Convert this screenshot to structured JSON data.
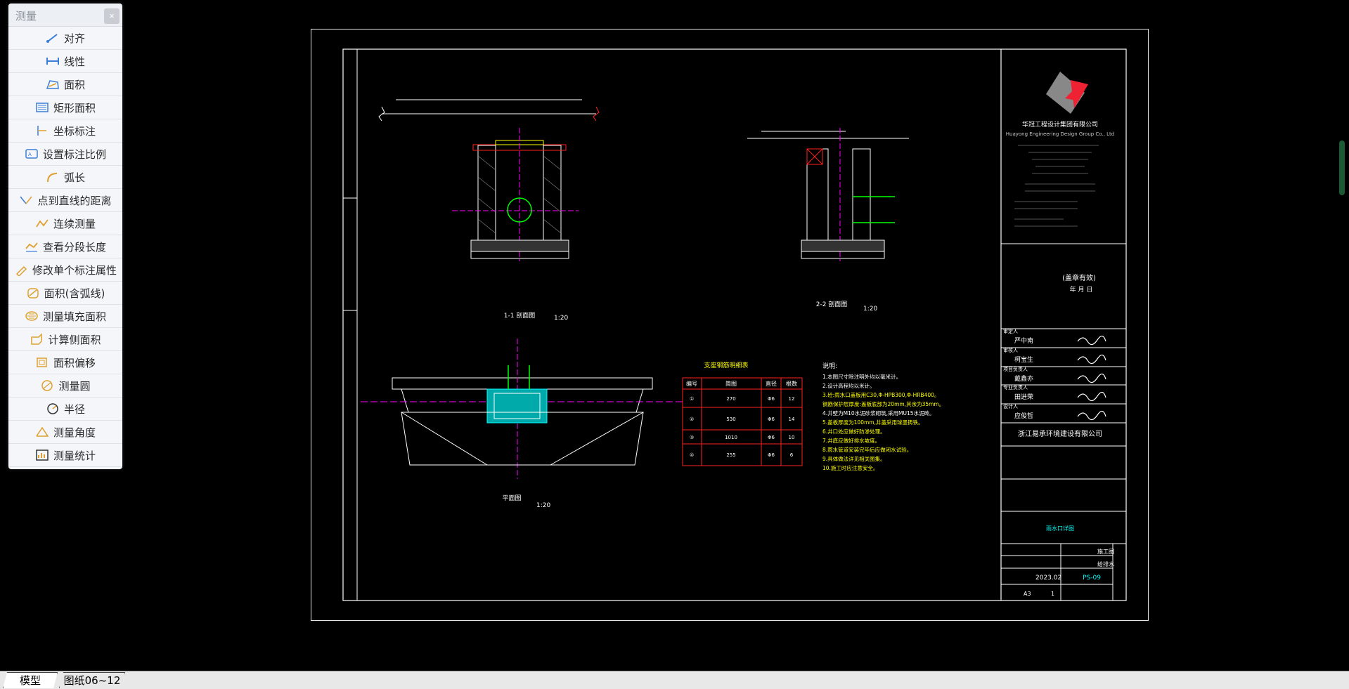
{
  "panel": {
    "title": "测量",
    "close": "×",
    "tools": [
      {
        "label": "对齐",
        "icon": "align-measure-icon"
      },
      {
        "label": "线性",
        "icon": "linear-measure-icon"
      },
      {
        "label": "面积",
        "icon": "area-icon"
      },
      {
        "label": "矩形面积",
        "icon": "rectangle-area-icon"
      },
      {
        "label": "坐标标注",
        "icon": "coordinate-icon"
      },
      {
        "label": "设置标注比例",
        "icon": "scale-icon"
      },
      {
        "label": "弧长",
        "icon": "arc-length-icon"
      },
      {
        "label": "点到直线的距离",
        "icon": "point-line-distance-icon"
      },
      {
        "label": "连续测量",
        "icon": "continuous-measure-icon"
      },
      {
        "label": "查看分段长度",
        "icon": "segment-length-icon"
      },
      {
        "label": "修改单个标注属性",
        "icon": "edit-dimension-icon"
      },
      {
        "label": "面积(含弧线)",
        "icon": "arc-area-icon"
      },
      {
        "label": "测量填充面积",
        "icon": "fill-area-icon"
      },
      {
        "label": "计算侧面积",
        "icon": "side-area-icon"
      },
      {
        "label": "面积偏移",
        "icon": "area-offset-icon"
      },
      {
        "label": "测量圆",
        "icon": "circle-measure-icon"
      },
      {
        "label": "半径",
        "icon": "radius-icon"
      },
      {
        "label": "测量角度",
        "icon": "angle-icon"
      },
      {
        "label": "测量统计",
        "icon": "statistics-icon"
      }
    ]
  },
  "tabs": {
    "model": "模型",
    "sheet": "图纸06~12"
  },
  "drawing": {
    "view1_label": "1-1 剖面图",
    "view1_scale": "1:20",
    "view2_label": "2-2 剖面图",
    "view2_scale": "1:20",
    "plan_label": "平面图",
    "plan_scale": "1:20",
    "rebar_table_title": "支座钢筋明细表",
    "rebar_headers": [
      "编号",
      "简图",
      "直径",
      "根数"
    ],
    "rebar_rows": [
      {
        "no": "①",
        "dim": "270",
        "dia": "Φ6",
        "qty": "12"
      },
      {
        "no": "②",
        "dim": "530",
        "dia": "Φ6",
        "qty": "14"
      },
      {
        "no": "③",
        "dim": "1010",
        "dia": "Φ6",
        "qty": "10"
      },
      {
        "no": "④",
        "dim": "255",
        "dia": "Φ6",
        "qty": "6"
      }
    ],
    "notes_title": "说明:",
    "notes": [
      "1.本图尺寸除注明外均以毫米计。",
      "2.设计高程均以米计。",
      "3.砼:雨水口盖板用C30,Φ-HPB300,Φ-HRB400。",
      "  钢筋保护层厚度:盖板底部为20mm,其余为35mm。",
      "4.井壁为M10水泥砂浆砌筑,采用MU15水泥砖。",
      "5.盖板厚度为100mm,井盖采用球墨铸铁。",
      "6.井口处应做好防渗处理。",
      "7.井底应做好排水坡度。",
      "8.雨水管道安装完毕后应做闭水试验。",
      "9.具体做法详见相关图集。",
      "10.施工时应注意安全。"
    ],
    "company_cn": "华冠工程设计集团有限公司",
    "company_en": "Huayong Engineering Design Group Co., Ltd",
    "client": "浙江易承环境建设有限公司",
    "drawing_title": "雨水口详图",
    "date": "2023.02",
    "sheet_no": "PS-09",
    "scale_note": "A3",
    "version": "1",
    "stage": "施工图",
    "discipline": "给排水",
    "stamp_text": "(盖章有效)",
    "year_month_day": "年  月  日",
    "persons": [
      {
        "role": "审定人",
        "name": "严中南"
      },
      {
        "role": "审核人",
        "name": "柯宝生"
      },
      {
        "role": "项目负责人",
        "name": "戴鑫亦"
      },
      {
        "role": "专业负责人",
        "name": "田进荣"
      },
      {
        "role": "设计人",
        "name": "应俊哲"
      },
      {
        "role": "设计人",
        "name": "田进荣"
      }
    ]
  },
  "colors": {
    "frame": "#ffffff",
    "yellow": "#ffff00",
    "red": "#ff2020",
    "magenta": "#ff00ff",
    "green": "#00ff00",
    "cyan": "#00ffff"
  }
}
